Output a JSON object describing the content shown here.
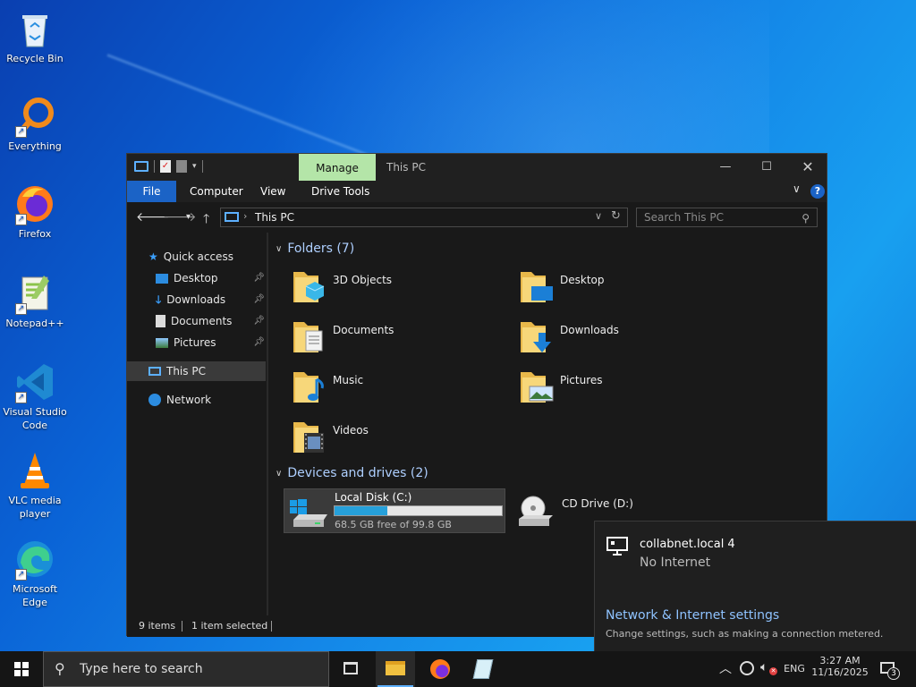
{
  "desktop": {
    "icons": [
      {
        "label": "Recycle Bin",
        "icon": "recycle-bin-icon"
      },
      {
        "label": "Everything",
        "icon": "everything-search-icon"
      },
      {
        "label": "Firefox",
        "icon": "firefox-icon"
      },
      {
        "label": "Notepad++",
        "icon": "notepadpp-icon"
      },
      {
        "label": "Visual Studio Code",
        "icon": "vscode-icon"
      },
      {
        "label": "VLC media player",
        "icon": "vlc-icon"
      },
      {
        "label": "Microsoft Edge",
        "icon": "edge-icon"
      }
    ]
  },
  "explorer": {
    "manage_tab": "Manage",
    "title": "This PC",
    "ribbon_tabs": [
      "File",
      "Computer",
      "View",
      "Drive Tools"
    ],
    "address": "This PC",
    "search_placeholder": "Search This PC",
    "nav_items": {
      "quick_access": "Quick access",
      "desktop": "Desktop",
      "downloads": "Downloads",
      "documents": "Documents",
      "pictures": "Pictures",
      "this_pc": "This PC",
      "network": "Network"
    },
    "folders_header": "Folders (7)",
    "folders": [
      "3D Objects",
      "Desktop",
      "Documents",
      "Downloads",
      "Music",
      "Pictures",
      "Videos"
    ],
    "drives_header": "Devices and drives (2)",
    "drives": {
      "c_name": "Local Disk (C:)",
      "c_free": "68.5 GB free of 99.8 GB",
      "c_used_fraction": 0.314,
      "d_name": "CD Drive (D:)"
    },
    "status": {
      "items": "9 items",
      "selected": "1 item selected"
    }
  },
  "network_popup": {
    "network_name": "collabnet.local 4",
    "network_status": "No Internet",
    "settings_link": "Network & Internet settings",
    "settings_desc": "Change settings, such as making a connection metered."
  },
  "taskbar": {
    "search_placeholder": "Type here to search",
    "language": "ENG",
    "time": "3:27 AM",
    "date": "11/16/2025",
    "notification_count": "3"
  },
  "colors": {
    "accent": "#1b63c6",
    "manage_tab": "#b4e5a8",
    "link": "#8fc3ff",
    "group_header": "#aecfff"
  }
}
